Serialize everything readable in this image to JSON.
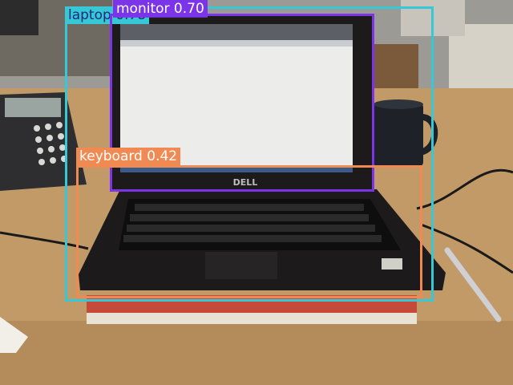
{
  "detections": [
    {
      "label": "laptop",
      "score": "0.78",
      "text": "laptop  0.78",
      "color": "#37c8d8",
      "text_color": "#1a2a7a"
    },
    {
      "label": "monitor",
      "score": "0.70",
      "text": "monitor  0.70",
      "color": "#7b34e8",
      "text_color": "#ffffff"
    },
    {
      "label": "keyboard",
      "score": "0.42",
      "text": "keyboard  0.42",
      "color": "#f08a52",
      "text_color": "#ffffff"
    }
  ],
  "laptop_logo": "DELL",
  "colors": {
    "desk": "#c29a68",
    "screen": "#ececea",
    "laptop_body": "#1c1a1a"
  }
}
